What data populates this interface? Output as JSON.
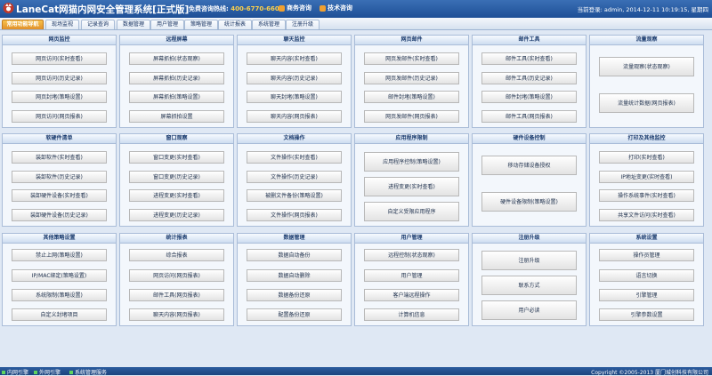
{
  "header": {
    "title": "LaneCat网猫内网安全管理系统[正式版]",
    "hotline_label": "免费咨询热线: ",
    "hotline_number": "400-6770-660",
    "biz_label": "商务咨询",
    "tech_label": "技术咨询",
    "user_info": "当前登录: admin, 2014-12-11 10:19:15, 星期四"
  },
  "tabs": [
    "常用功能导航",
    "现场监视",
    "记录查询",
    "数据管理",
    "用户管理",
    "策略管理",
    "统计报表",
    "系统管理",
    "注册升级"
  ],
  "panels": [
    {
      "title": "网页监控",
      "buttons": [
        "网页访问(实时查看)",
        "网页访问(历史记录)",
        "网页封堵(策略设置)",
        "网页访问(网页报表)"
      ]
    },
    {
      "title": "远程屏幕",
      "buttons": [
        "屏幕抓拍(状态观察)",
        "屏幕抓拍(历史记录)",
        "屏幕抓拍(策略设置)",
        "屏幕抓拍设置"
      ]
    },
    {
      "title": "聊天监控",
      "buttons": [
        "聊天内容(实时查看)",
        "聊天内容(历史记录)",
        "聊天封堵(策略设置)",
        "聊天内容(网页报表)"
      ]
    },
    {
      "title": "网页邮件",
      "buttons": [
        "网页发邮件(实时查看)",
        "网页发邮件(历史记录)",
        "邮件封堵(策略设置)",
        "网页发邮件(网页报表)"
      ]
    },
    {
      "title": "邮件工具",
      "buttons": [
        "邮件工具(实时查看)",
        "邮件工具(历史记录)",
        "邮件封堵(策略设置)",
        "邮件工具(网页报表)"
      ]
    },
    {
      "title": "流量观察",
      "buttons": [
        "流量观察(状态观察)",
        "流量统计数据(网页报表)"
      ]
    },
    {
      "title": "软硬件清单",
      "buttons": [
        "装卸软件(实时查看)",
        "装卸软件(历史记录)",
        "装卸硬件设备(实时查看)",
        "装卸硬件设备(历史记录)"
      ]
    },
    {
      "title": "窗口观察",
      "buttons": [
        "窗口变更(实时查看)",
        "窗口变更(历史记录)",
        "进程变更(实时查看)",
        "进程变更(历史记录)"
      ]
    },
    {
      "title": "文档操作",
      "buttons": [
        "文件操作(实时查看)",
        "文件操作(历史记录)",
        "被删文件备份(策略设置)",
        "文件操作(网页报表)"
      ]
    },
    {
      "title": "应用程序限制",
      "buttons": [
        "应用程序控制(策略设置)",
        "进程变更(实时查看)",
        "自定义受限应用程序"
      ]
    },
    {
      "title": "硬件设备控制",
      "buttons": [
        "移动存储设备授权",
        "硬件设备限制(策略设置)"
      ]
    },
    {
      "title": "打印及其他监控",
      "buttons": [
        "打印(实时查看)",
        "IP地址变更(实时查看)",
        "操作系统事件(实时查看)",
        "共享文件访问(实时查看)"
      ]
    },
    {
      "title": "其他策略设置",
      "buttons": [
        "禁止上网(策略设置)",
        "IP/MAC绑定(策略设置)",
        "系统限制(策略设置)",
        "自定义封堵项目"
      ]
    },
    {
      "title": "统计报表",
      "buttons": [
        "综合报表",
        "网页访问(网页报表)",
        "邮件工具(网页报表)",
        "聊天内容(网页报表)"
      ]
    },
    {
      "title": "数据管理",
      "buttons": [
        "数据自动备份",
        "数据自动删除",
        "数据备份还原",
        "配置备份还原"
      ]
    },
    {
      "title": "用户管理",
      "buttons": [
        "远程控制(状态观察)",
        "用户管理",
        "客户端远程操作",
        "计算机信息"
      ]
    },
    {
      "title": "注册升级",
      "buttons": [
        "注册升级",
        "联系方式",
        "用户必读"
      ]
    },
    {
      "title": "系统设置",
      "buttons": [
        "操作员管理",
        "语言切换",
        "引擎管理",
        "引擎参数设置"
      ]
    }
  ],
  "footer": {
    "items": [
      "内网引擎",
      "外网引擎",
      "系统管理服务"
    ],
    "copyright": "Copyright ©2005-2013 厦门城创科技有限公司"
  },
  "colors": {
    "header": "#1e4f96",
    "active_tab": "#e0902a",
    "hotline": "#ffd24a"
  }
}
